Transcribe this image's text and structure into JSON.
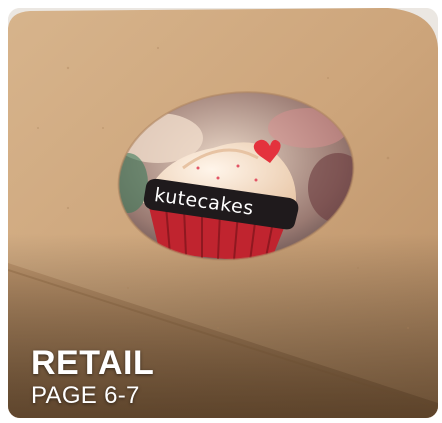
{
  "card": {
    "title": "RETAIL",
    "subtitle": "PAGE 6-7"
  },
  "product_label": {
    "brand": "kutecakes"
  },
  "colors": {
    "kraft": "#c9a47c",
    "kraft_dark": "#b48b61",
    "label_band": "#1f1a1c",
    "cupcake_liner": "#c0242f",
    "frosting": "#f4e1cf"
  }
}
